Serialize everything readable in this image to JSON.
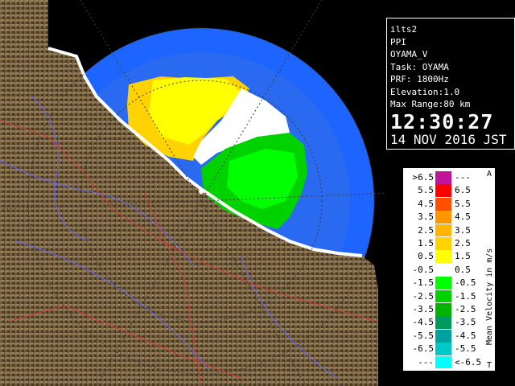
{
  "info": {
    "lines": [
      "ilts2",
      "PPI",
      "OYAMA_V",
      "Task: OYAMA",
      "PRF: 1800Hz",
      "Elevation:1.0",
      "Max Range:80 km"
    ],
    "time": "12:30:27",
    "date": "14 NOV 2016 JST"
  },
  "legend": {
    "title": "Mean Velocity in m/s",
    "top_marker": "A",
    "bottom_marker": "T",
    "rows": [
      {
        "lo": ">6.5",
        "hi": "---",
        "color": "#c0149b"
      },
      {
        "lo": "5.5",
        "hi": "6.5",
        "color": "#ff0000"
      },
      {
        "lo": "4.5",
        "hi": "5.5",
        "color": "#ff5000"
      },
      {
        "lo": "3.5",
        "hi": "4.5",
        "color": "#ff9600"
      },
      {
        "lo": "2.5",
        "hi": "3.5",
        "color": "#ffb400"
      },
      {
        "lo": "1.5",
        "hi": "2.5",
        "color": "#ffd200"
      },
      {
        "lo": "0.5",
        "hi": "1.5",
        "color": "#ffff00"
      },
      {
        "lo": "-0.5",
        "hi": "0.5",
        "color": "#ffffff"
      },
      {
        "lo": "-1.5",
        "hi": "-0.5",
        "color": "#00ff00"
      },
      {
        "lo": "-2.5",
        "hi": "-1.5",
        "color": "#00d200"
      },
      {
        "lo": "-3.5",
        "hi": "-2.5",
        "color": "#00b400"
      },
      {
        "lo": "-4.5",
        "hi": "-3.5",
        "color": "#009b5a"
      },
      {
        "lo": "-5.5",
        "hi": "-4.5",
        "color": "#00a0a0"
      },
      {
        "lo": "-6.5",
        "hi": "-5.5",
        "color": "#00c8c8"
      },
      {
        "lo": "---",
        "hi": "<-6.5",
        "color": "#00ffff"
      }
    ]
  },
  "colors": {
    "sea": "#1e64ff",
    "range_ring": "#2a6af0",
    "land": "#6e5a3c",
    "river": "#6464ff",
    "border": "#d23c3c"
  }
}
